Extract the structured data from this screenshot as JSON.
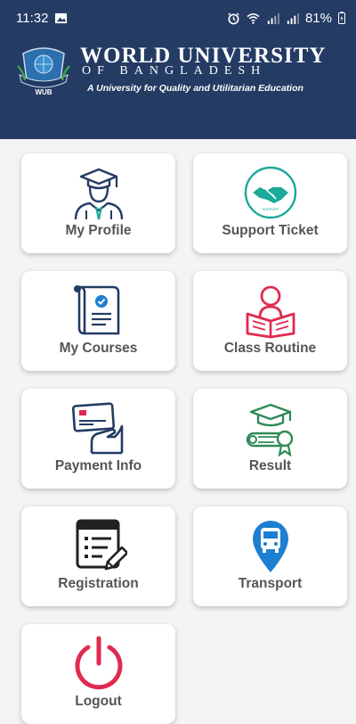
{
  "status_bar": {
    "time": "11:32",
    "battery": "81%",
    "icons": [
      "image-icon",
      "alarm-icon",
      "wifi-icon",
      "signal-icon",
      "signal-icon",
      "battery-icon"
    ]
  },
  "header": {
    "title": "WORLD UNIVERSITY",
    "subtitle": "OF BANGLADESH",
    "tagline": "A University for Quality and Utilitarian Education",
    "logo_text": "WUB",
    "background": "#243b64"
  },
  "menu": [
    {
      "label": "My Profile",
      "icon": "graduate-profile-icon"
    },
    {
      "label": "Support Ticket",
      "icon": "handshake-support-icon"
    },
    {
      "label": "My Courses",
      "icon": "certificate-scroll-icon"
    },
    {
      "label": "Class Routine",
      "icon": "reading-person-icon"
    },
    {
      "label": "Payment Info",
      "icon": "card-payment-icon"
    },
    {
      "label": "Result",
      "icon": "diploma-cap-icon"
    },
    {
      "label": "Registration",
      "icon": "registration-form-icon"
    },
    {
      "label": "Transport",
      "icon": "bus-location-icon"
    },
    {
      "label": "Logout",
      "icon": "power-icon"
    }
  ],
  "colors": {
    "navy": "#243b64",
    "teal": "#1aa99a",
    "red": "#e02a4f",
    "green": "#2e8b57",
    "blue": "#1d7fd1",
    "label": "#555555"
  }
}
